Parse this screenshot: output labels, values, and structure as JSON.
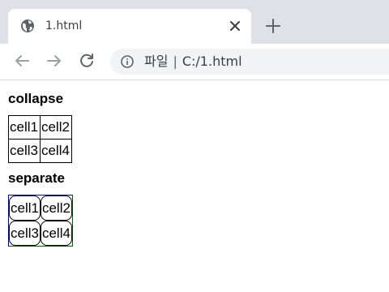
{
  "browser": {
    "tab_title": "1.html",
    "address_prefix": "파일",
    "address_separator": "|",
    "address_url": "C:/1.html"
  },
  "icons": {
    "favicon": "globe-icon",
    "close": "close-icon",
    "new_tab": "plus-icon",
    "back": "back-arrow-icon",
    "forward": "forward-arrow-icon",
    "reload": "reload-icon",
    "site_info": "info-icon"
  },
  "page": {
    "heading_collapse": "collapse",
    "heading_separate": "separate",
    "collapse_table": [
      [
        "cell1",
        "cell2"
      ],
      [
        "cell3",
        "cell4"
      ]
    ],
    "separate_table": [
      [
        "cell1",
        "cell2"
      ],
      [
        "cell3",
        "cell4"
      ]
    ]
  },
  "colors": {
    "tabstrip": "#dee1e6",
    "omnibox": "#f1f3f4",
    "separate_border_top_left": "#0000cc",
    "separate_border_bottom_right": "#006400"
  }
}
